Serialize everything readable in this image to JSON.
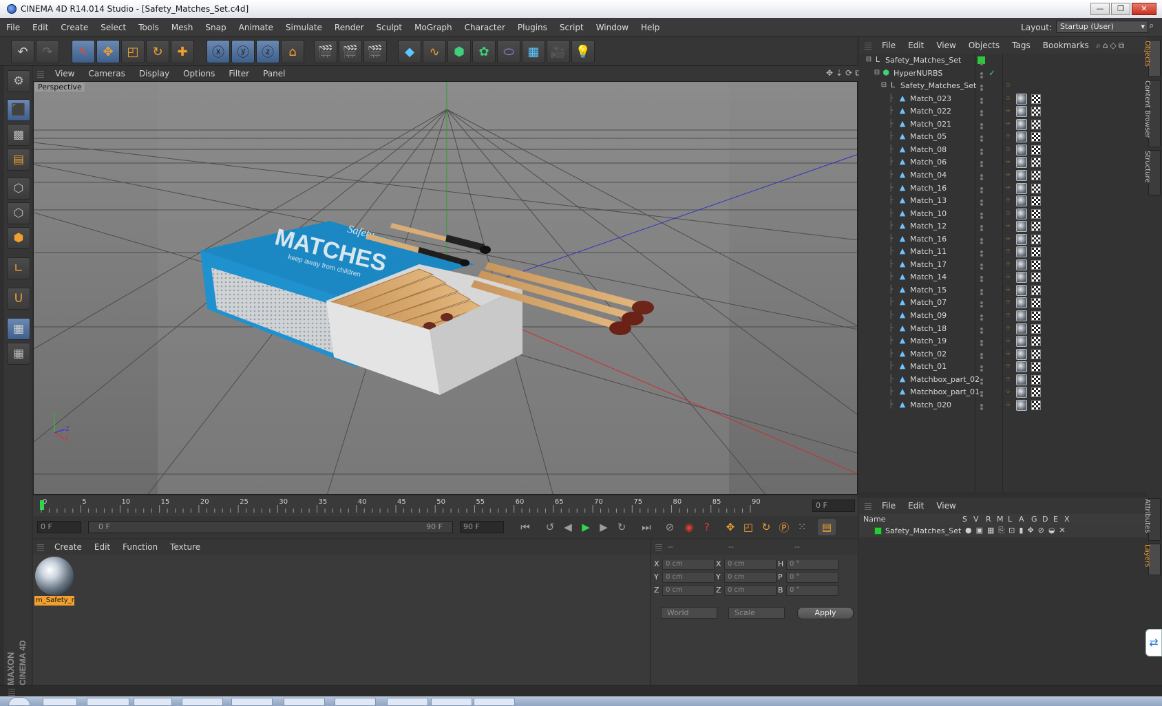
{
  "window": {
    "title": "CINEMA 4D R14.014 Studio - [Safety_Matches_Set.c4d]",
    "min_glyph": "—",
    "max_glyph": "❐",
    "close_glyph": "✕"
  },
  "menubar": {
    "items": [
      "File",
      "Edit",
      "Create",
      "Select",
      "Tools",
      "Mesh",
      "Snap",
      "Animate",
      "Simulate",
      "Render",
      "Sculpt",
      "MoGraph",
      "Character",
      "Plugins",
      "Script",
      "Window",
      "Help"
    ],
    "layout_label": "Layout:",
    "layout_value": "Startup (User)"
  },
  "viewport": {
    "menu": [
      "View",
      "Cameras",
      "Display",
      "Options",
      "Filter",
      "Panel"
    ],
    "label": "Perspective",
    "axis": {
      "x": "X",
      "y": "Y",
      "z": "Z"
    },
    "box_front_text": "MATCHES",
    "box_script_text": "Safety",
    "box_sub_text": "keep away from children"
  },
  "timeline": {
    "ticks": [
      "0",
      "5",
      "10",
      "15",
      "20",
      "25",
      "30",
      "35",
      "40",
      "45",
      "50",
      "55",
      "60",
      "65",
      "70",
      "75",
      "80",
      "85",
      "90"
    ],
    "frame_end_field": "0 F"
  },
  "transport": {
    "current_frame": "0 F",
    "range_start": "0 F",
    "range_end": "90 F",
    "end_frame": "90 F"
  },
  "materials": {
    "menu": [
      "Create",
      "Edit",
      "Function",
      "Texture"
    ],
    "items": [
      {
        "name": "m_Safety_n"
      }
    ]
  },
  "coordinates": {
    "headers": [
      "--",
      "--",
      "--"
    ],
    "rows": [
      {
        "a": "X",
        "a_val": "0 cm",
        "b": "X",
        "b_val": "0 cm",
        "c": "H",
        "c_val": "0 °"
      },
      {
        "a": "Y",
        "a_val": "0 cm",
        "b": "Y",
        "b_val": "0 cm",
        "c": "P",
        "c_val": "0 °"
      },
      {
        "a": "Z",
        "a_val": "0 cm",
        "b": "Z",
        "b_val": "0 cm",
        "c": "B",
        "c_val": "0 °"
      }
    ],
    "space": "World",
    "mode": "Scale",
    "apply": "Apply"
  },
  "objects": {
    "menu": [
      "File",
      "Edit",
      "View",
      "Objects",
      "Tags",
      "Bookmarks"
    ],
    "tree": [
      {
        "name": "Safety_Matches_Set",
        "level": 0,
        "kind": "null"
      },
      {
        "name": "HyperNURBS",
        "level": 1,
        "kind": "nurbs"
      },
      {
        "name": "Safety_Matches_Set",
        "level": 2,
        "kind": "null"
      },
      {
        "name": "Match_023",
        "level": 3,
        "kind": "poly"
      },
      {
        "name": "Match_022",
        "level": 3,
        "kind": "poly"
      },
      {
        "name": "Match_021",
        "level": 3,
        "kind": "poly"
      },
      {
        "name": "Match_05",
        "level": 3,
        "kind": "poly"
      },
      {
        "name": "Match_08",
        "level": 3,
        "kind": "poly"
      },
      {
        "name": "Match_06",
        "level": 3,
        "kind": "poly"
      },
      {
        "name": "Match_04",
        "level": 3,
        "kind": "poly"
      },
      {
        "name": "Match_16",
        "level": 3,
        "kind": "poly"
      },
      {
        "name": "Match_13",
        "level": 3,
        "kind": "poly"
      },
      {
        "name": "Match_10",
        "level": 3,
        "kind": "poly"
      },
      {
        "name": "Match_12",
        "level": 3,
        "kind": "poly"
      },
      {
        "name": "Match_16",
        "level": 3,
        "kind": "poly"
      },
      {
        "name": "Match_11",
        "level": 3,
        "kind": "poly"
      },
      {
        "name": "Match_17",
        "level": 3,
        "kind": "poly"
      },
      {
        "name": "Match_14",
        "level": 3,
        "kind": "poly"
      },
      {
        "name": "Match_15",
        "level": 3,
        "kind": "poly"
      },
      {
        "name": "Match_07",
        "level": 3,
        "kind": "poly"
      },
      {
        "name": "Match_09",
        "level": 3,
        "kind": "poly"
      },
      {
        "name": "Match_18",
        "level": 3,
        "kind": "poly"
      },
      {
        "name": "Match_19",
        "level": 3,
        "kind": "poly"
      },
      {
        "name": "Match_02",
        "level": 3,
        "kind": "poly"
      },
      {
        "name": "Match_01",
        "level": 3,
        "kind": "poly"
      },
      {
        "name": "Matchbox_part_02",
        "level": 3,
        "kind": "poly"
      },
      {
        "name": "Matchbox_part_01",
        "level": 3,
        "kind": "poly"
      },
      {
        "name": "Match_020",
        "level": 3,
        "kind": "poly"
      }
    ]
  },
  "layers": {
    "menu": [
      "File",
      "Edit",
      "View"
    ],
    "columns": [
      "Name",
      "S",
      "V",
      "R",
      "M",
      "L",
      "A",
      "G",
      "D",
      "E",
      "X"
    ],
    "rows": [
      {
        "name": "Safety_Matches_Set",
        "color": "#29c93a"
      }
    ]
  },
  "side_tabs": [
    "Objects",
    "Content Browser",
    "Structure",
    "Attributes",
    "Layers"
  ],
  "brand": {
    "line1": "MAXON",
    "line2": "CINEMA 4D"
  },
  "colors": {
    "accent": "#f0a030",
    "selection": "#4a6f9e",
    "green_layer": "#29c93a"
  }
}
